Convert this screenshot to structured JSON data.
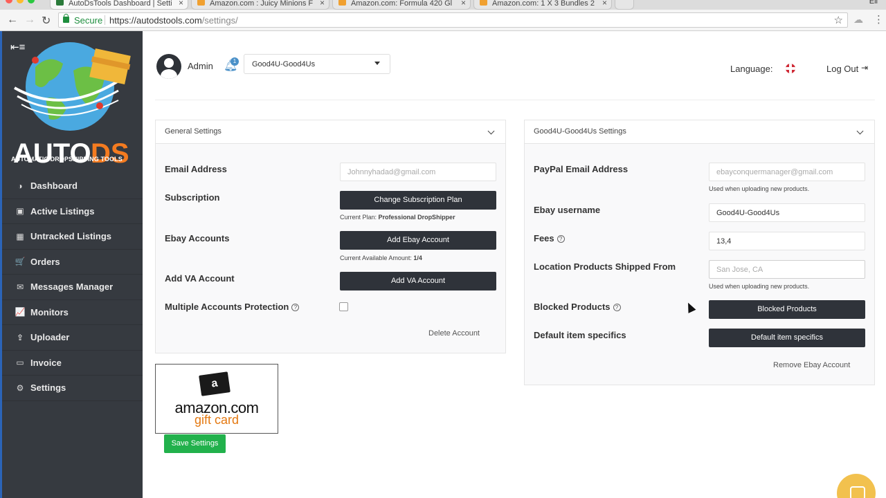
{
  "browser": {
    "tabs": [
      {
        "label": "AutoDsTools Dashboard | Setti",
        "active": true,
        "icon": "autods-favicon"
      },
      {
        "label": "Amazon.com : Juicy Minions F",
        "active": false,
        "icon": "amazon-favicon"
      },
      {
        "label": "Amazon.com: Formula 420 Gl",
        "active": false,
        "icon": "amazon-favicon"
      },
      {
        "label": "Amazon.com: 1 X 3 Bundles 2",
        "active": false,
        "icon": "amazon-favicon"
      }
    ],
    "profile_label": "Eli",
    "secure_label": "Secure",
    "url_host": "https://autodstools.com",
    "url_path": "/settings/"
  },
  "sidebar": {
    "logo_text": "AUTODS",
    "logo_tagline": "AUTOMATIC DROPSHIPPING TOOLS",
    "items": [
      {
        "label": "Dashboard",
        "icon": "palette-icon"
      },
      {
        "label": "Active Listings",
        "icon": "calendar-check-icon"
      },
      {
        "label": "Untracked Listings",
        "icon": "calendar-icon"
      },
      {
        "label": "Orders",
        "icon": "cart-icon"
      },
      {
        "label": "Messages Manager",
        "icon": "envelope-icon"
      },
      {
        "label": "Monitors",
        "icon": "line-chart-icon"
      },
      {
        "label": "Uploader",
        "icon": "upload-icon"
      },
      {
        "label": "Invoice",
        "icon": "credit-card-icon"
      },
      {
        "label": "Settings",
        "icon": "gear-icon"
      }
    ]
  },
  "header": {
    "user_name": "Admin",
    "notification_count": "1",
    "account_selected": "Good4U-Good4Us",
    "language_label": "Language:",
    "logout_label": "Log Out"
  },
  "general": {
    "title": "General Settings",
    "email_label": "Email Address",
    "email_placeholder": "Johnnyhadad@gmail.com",
    "subscription_label": "Subscription",
    "change_plan_button": "Change Subscription Plan",
    "current_plan_label": "Current Plan:",
    "current_plan_value": "Professional DropShipper",
    "ebay_accounts_label": "Ebay Accounts",
    "add_ebay_button": "Add Ebay Account",
    "available_label": "Current Available Amount:",
    "available_value": "1/4",
    "va_label": "Add VA Account",
    "add_va_button": "Add VA Account",
    "protection_label": "Multiple Accounts Protection",
    "protection_checked": false,
    "delete_link": "Delete Account"
  },
  "account": {
    "title": "Good4U-Good4Us Settings",
    "paypal_label": "PayPal Email Address",
    "paypal_placeholder": "ebayconquermanager@gmail.com",
    "paypal_note": "Used when uploading new products.",
    "ebay_user_label": "Ebay username",
    "ebay_user_value": "Good4U-Good4Us",
    "fees_label": "Fees",
    "fees_value": "13,4",
    "location_label": "Location Products Shipped From",
    "location_placeholder": "San Jose, CA",
    "location_note": "Used when uploading new products.",
    "blocked_label": "Blocked Products",
    "blocked_button": "Blocked Products",
    "specifics_label": "Default item specifics",
    "specifics_button": "Default item specifics",
    "remove_link": "Remove Ebay Account"
  },
  "giftcard": {
    "line1": "amazon.com",
    "line2": "gift card",
    "bag_letter": "a"
  },
  "save_button": "Save Settings",
  "colors": {
    "sidebar_bg": "#363a40",
    "button_dark": "#2f333a",
    "save_green": "#22b14c",
    "bell_blue": "#4a90c8",
    "logo_orange": "#f47b20",
    "chat_yellow": "#f2c14e"
  }
}
